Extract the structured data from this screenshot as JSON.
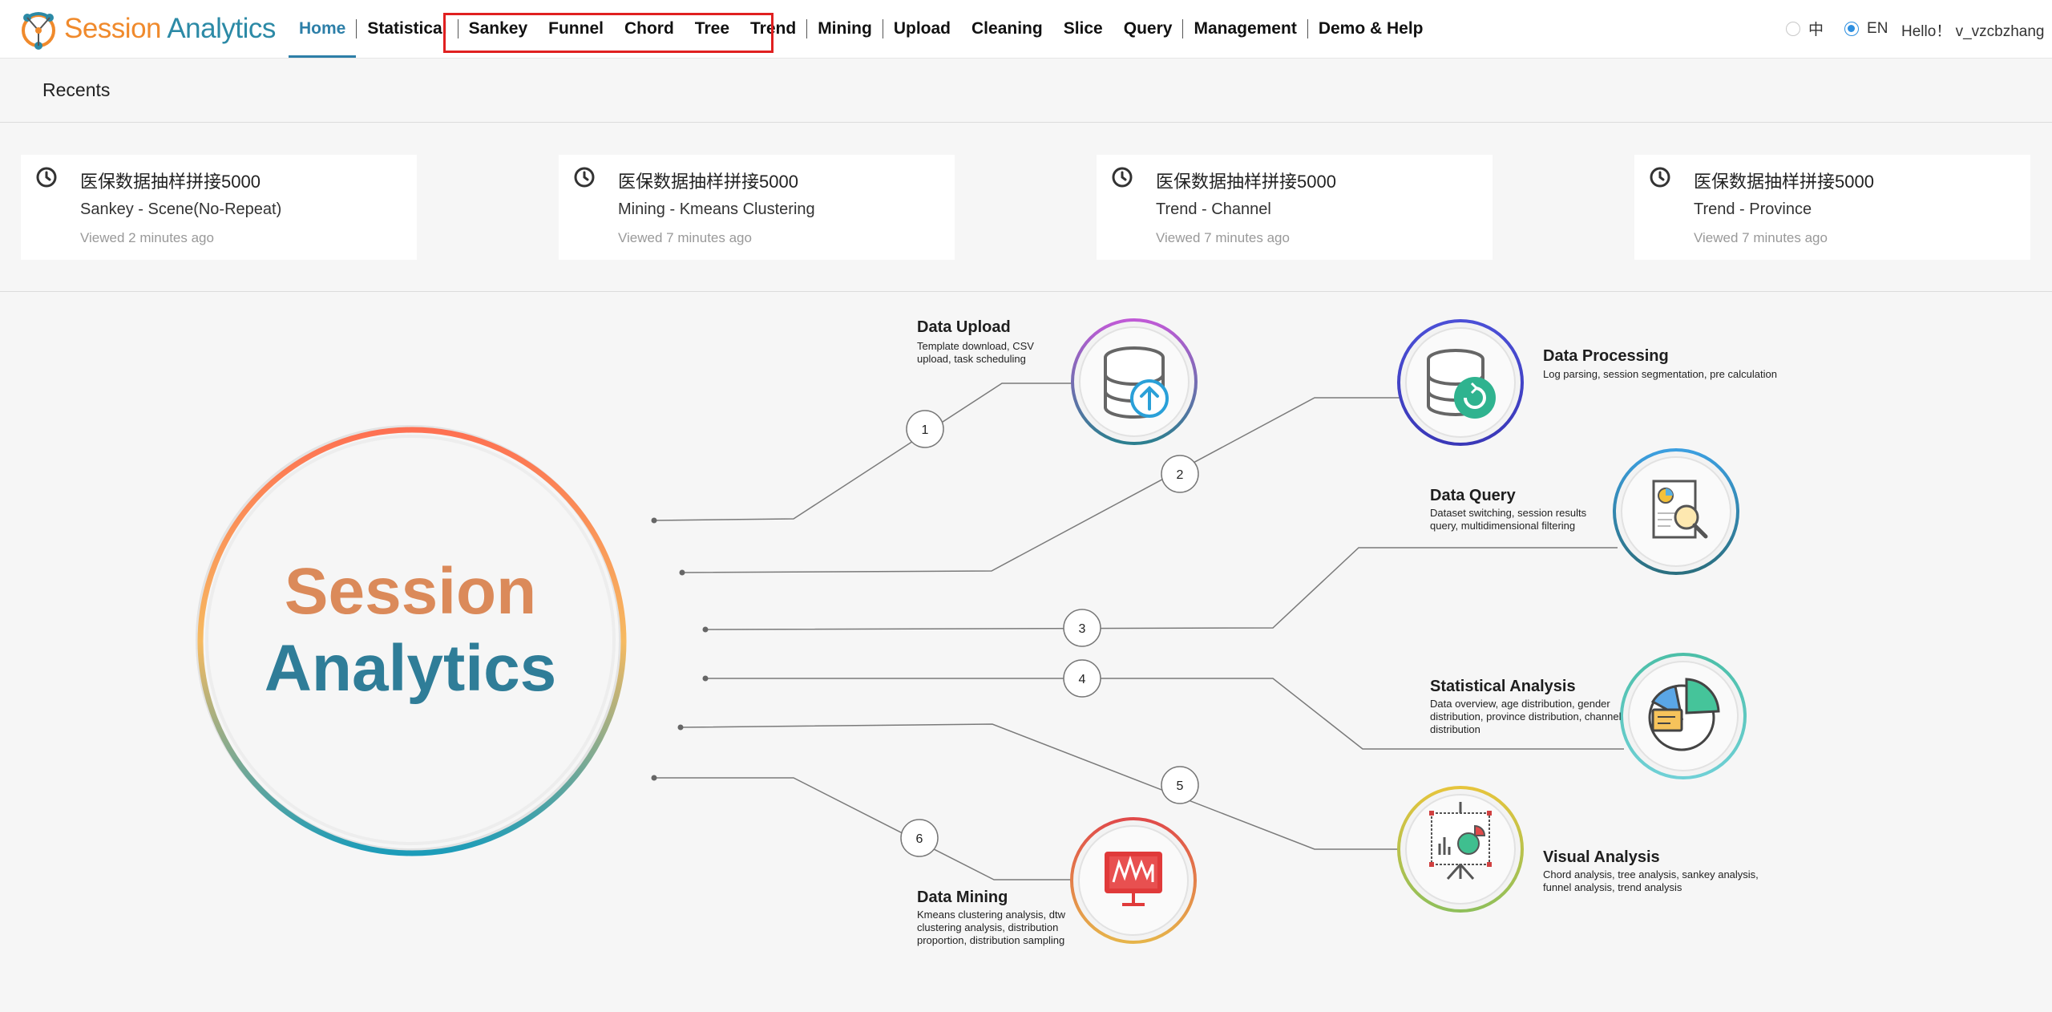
{
  "brand": {
    "word1": "Session",
    "word2": " Analytics"
  },
  "nav": {
    "home": "Home",
    "statistical": "Statistical",
    "sankey": "Sankey",
    "funnel": "Funnel",
    "chord": "Chord",
    "tree": "Tree",
    "trend": "Trend",
    "mining": "Mining",
    "upload": "Upload",
    "cleaning": "Cleaning",
    "slice": "Slice",
    "query": "Query",
    "management": "Management",
    "demo_help": "Demo & Help"
  },
  "language": {
    "zh": "中",
    "en": "EN",
    "selected": "EN"
  },
  "user": {
    "greeting": "Hello！ v_vzcbzhang"
  },
  "recents": {
    "title": "Recents",
    "items": [
      {
        "title": "医保数据抽样拼接5000",
        "subtitle": "Sankey - Scene(No-Repeat)",
        "time": "Viewed 2 minutes ago"
      },
      {
        "title": "医保数据抽样拼接5000",
        "subtitle": "Mining - Kmeans Clustering",
        "time": "Viewed 7 minutes ago"
      },
      {
        "title": "医保数据抽样拼接5000",
        "subtitle": "Trend - Channel",
        "time": "Viewed 7 minutes ago"
      },
      {
        "title": "医保数据抽样拼接5000",
        "subtitle": "Trend - Province",
        "time": "Viewed 7 minutes ago"
      }
    ]
  },
  "hub": {
    "line1": "Session",
    "line2": "Analytics"
  },
  "features": [
    {
      "num": "1",
      "title": "Data Upload",
      "desc": "Template download, CSV upload, task scheduling"
    },
    {
      "num": "2",
      "title": "Data Processing",
      "desc": "Log parsing, session segmentation, pre calculation"
    },
    {
      "num": "3",
      "title": "Data Query",
      "desc": "Dataset switching, session results query, multidimensional filtering"
    },
    {
      "num": "4",
      "title": "Statistical Analysis",
      "desc": "Data overview, age distribution, gender distribution, province distribution, channel distribution"
    },
    {
      "num": "5",
      "title": "Visual Analysis",
      "desc": "Chord analysis, tree analysis, sankey analysis, funnel analysis, trend analysis"
    },
    {
      "num": "6",
      "title": "Data Mining",
      "desc": "Kmeans clustering analysis, dtw clustering analysis, distribution proportion, distribution sampling"
    }
  ],
  "colors": {
    "brand_orange": "#f08a2c",
    "brand_teal": "#2c8aa6",
    "active_nav": "#2d7fa8",
    "highlight_box": "#e02020"
  }
}
